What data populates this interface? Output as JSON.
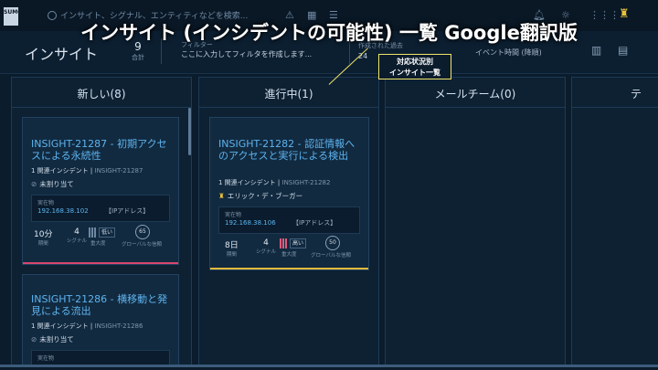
{
  "app": {
    "logo": "SUMO",
    "search_placeholder": "インサイト、シグナル、エンティティなどを検索..."
  },
  "banner": {
    "text": "インサイト (インシデントの可能性) 一覧 Google翻訳版"
  },
  "header": {
    "title": "インサイト",
    "count": "9",
    "count_label": "合計",
    "filter_label": "フィルター",
    "filter_placeholder": "ここに入力してフィルタを作成します...",
    "created_label": "作成された過去",
    "created_value": "24",
    "sort_value": "イベント時間 (降順)"
  },
  "callout": {
    "line1": "対応状況別",
    "line2": "インサイト一覧"
  },
  "columns": [
    {
      "title": "新しい(8)"
    },
    {
      "title": "進行中(1)"
    },
    {
      "title": "メールチーム(0)"
    },
    {
      "title": "テ"
    }
  ],
  "cards": [
    {
      "title": "INSIGHT-21287 - 初期アクセスによる永続性",
      "related": "1 関連インシデント",
      "id": "INSIGHT-21287",
      "assignee": "未割り当て",
      "entity_label": "実在物",
      "ip": "192.168.38.102",
      "entity_type": "【IPアドレス】",
      "duration": "10分",
      "duration_label": "期間",
      "signals": "4",
      "signals_label": "シグナル",
      "severity": "低い",
      "severity_label": "重大度",
      "confidence": "65",
      "confidence_label": "グローバルな信頼",
      "bar_color": "#d9486f"
    },
    {
      "title": "INSIGHT-21282 - 認証情報へのアクセスと実行による検出",
      "related": "1 関連インシデント",
      "id": "INSIGHT-21282",
      "assignee": "エリック・デ・ブーガー",
      "entity_label": "実在物",
      "ip": "192.168.38.106",
      "entity_type": "【IPアドレス】",
      "duration": "8日",
      "duration_label": "期間",
      "signals": "4",
      "signals_label": "シグナル",
      "severity": "高い",
      "severity_label": "重大度",
      "confidence": "50",
      "confidence_label": "グローバルな信頼",
      "bar_color": "#e6b93a"
    },
    {
      "title": "INSIGHT-21286 - 横移動と発見による流出",
      "related": "1 関連インシデント",
      "id": "INSIGHT-21286",
      "assignee": "未割り当て",
      "entity_label": "実在物"
    }
  ]
}
